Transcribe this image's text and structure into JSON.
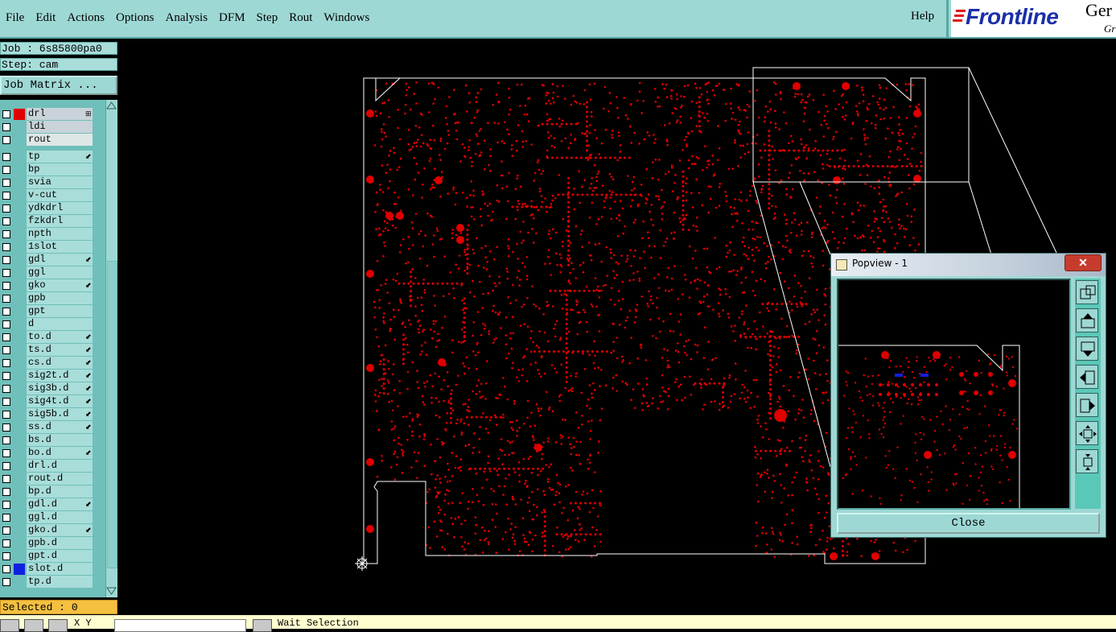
{
  "menubar": {
    "items": [
      "File",
      "Edit",
      "Actions",
      "Options",
      "Analysis",
      "DFM",
      "Step",
      "Rout",
      "Windows"
    ],
    "help": "Help"
  },
  "logo": {
    "brand": "Frontline",
    "suffix": "Ger",
    "suffix2": "Gr"
  },
  "job": {
    "job_line": "Job : 6s85800pa0",
    "step_line": "Step: cam",
    "matrix_button": "Job Matrix ..."
  },
  "layers": [
    {
      "name": "drl",
      "color": "#e00000",
      "highlight": true,
      "mark": "⊞"
    },
    {
      "name": "ldi",
      "color": "",
      "highlight": true,
      "mark": ""
    },
    {
      "name": "rout",
      "color": "",
      "highlight": false,
      "mark": ""
    },
    {
      "name": "tp",
      "color": "",
      "mark": "⬋"
    },
    {
      "name": "bp",
      "color": "",
      "mark": ""
    },
    {
      "name": "svia",
      "color": "",
      "mark": ""
    },
    {
      "name": "v-cut",
      "color": "",
      "mark": ""
    },
    {
      "name": "ydkdrl",
      "color": "",
      "mark": ""
    },
    {
      "name": "fzkdrl",
      "color": "",
      "mark": ""
    },
    {
      "name": "npth",
      "color": "",
      "mark": ""
    },
    {
      "name": "1slot",
      "color": "",
      "mark": ""
    },
    {
      "name": "gdl",
      "color": "",
      "mark": "⬋"
    },
    {
      "name": "ggl",
      "color": "",
      "mark": ""
    },
    {
      "name": "gko",
      "color": "",
      "mark": "⬋"
    },
    {
      "name": "gpb",
      "color": "",
      "mark": ""
    },
    {
      "name": "gpt",
      "color": "",
      "mark": ""
    },
    {
      "name": "d",
      "color": "",
      "mark": ""
    },
    {
      "name": "to.d",
      "color": "",
      "mark": "⬋"
    },
    {
      "name": "ts.d",
      "color": "",
      "mark": "⬋"
    },
    {
      "name": "cs.d",
      "color": "",
      "mark": "⬋"
    },
    {
      "name": "sig2t.d",
      "color": "",
      "mark": "⬋"
    },
    {
      "name": "sig3b.d",
      "color": "",
      "mark": "⬋"
    },
    {
      "name": "sig4t.d",
      "color": "",
      "mark": "⬋"
    },
    {
      "name": "sig5b.d",
      "color": "",
      "mark": "⬋"
    },
    {
      "name": "ss.d",
      "color": "",
      "mark": "⬋"
    },
    {
      "name": "bs.d",
      "color": "",
      "mark": ""
    },
    {
      "name": "bo.d",
      "color": "",
      "mark": "⬋"
    },
    {
      "name": "drl.d",
      "color": "",
      "mark": ""
    },
    {
      "name": "rout.d",
      "color": "",
      "mark": ""
    },
    {
      "name": "bp.d",
      "color": "",
      "mark": ""
    },
    {
      "name": "gdl.d",
      "color": "",
      "mark": "⬋"
    },
    {
      "name": "ggl.d",
      "color": "",
      "mark": ""
    },
    {
      "name": "gko.d",
      "color": "",
      "mark": "⬋"
    },
    {
      "name": "gpb.d",
      "color": "",
      "mark": ""
    },
    {
      "name": "gpt.d",
      "color": "",
      "mark": ""
    },
    {
      "name": "slot.d",
      "color": "#1020e0",
      "mark": ""
    },
    {
      "name": "tp.d",
      "color": "",
      "mark": ""
    }
  ],
  "selected": "Selected : 0",
  "bottombar": {
    "xy_label": "X Y",
    "message": "Wait Selection"
  },
  "popview": {
    "title": "Popview - 1",
    "close_label": "Close"
  },
  "colors": {
    "panel": "#9ed8d4",
    "drill": "#e00000",
    "slot": "#1020e0",
    "outline": "#ffffff",
    "selected_bar": "#f5c040"
  },
  "icons": [
    "menu-bar",
    "layer-checkbox",
    "popview-window-icon",
    "close-x-icon",
    "zoom-fit-icon",
    "pan-up-icon",
    "pan-down-icon",
    "pan-left-icon",
    "pan-right-icon",
    "zoom-in-icon",
    "zoom-out-icon",
    "origin-crosshair-icon"
  ]
}
